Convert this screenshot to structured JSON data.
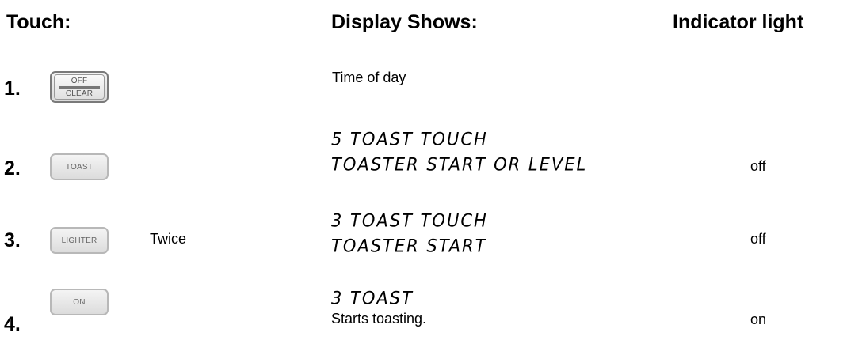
{
  "headers": {
    "touch": "Touch:",
    "display": "Display Shows:",
    "indicator": "Indicator light"
  },
  "steps": [
    {
      "number": "1.",
      "button_top": "OFF",
      "button_bottom": "CLEAR",
      "note": "",
      "display_lines": [
        "Time of day"
      ],
      "indicator": ""
    },
    {
      "number": "2.",
      "button": "TOAST",
      "note": "",
      "display_lines": [
        "5 TOAST TOUCH",
        "TOASTER START OR LEVEL"
      ],
      "indicator": "off"
    },
    {
      "number": "3.",
      "button": "LIGHTER",
      "note": "Twice",
      "display_lines": [
        "3 TOAST TOUCH",
        "TOASTER START"
      ],
      "indicator": "off"
    },
    {
      "number": "4.",
      "button": "ON",
      "note": "",
      "display_lines": [
        "3 TOAST"
      ],
      "display_note": "Starts toasting.",
      "indicator": "on"
    }
  ]
}
